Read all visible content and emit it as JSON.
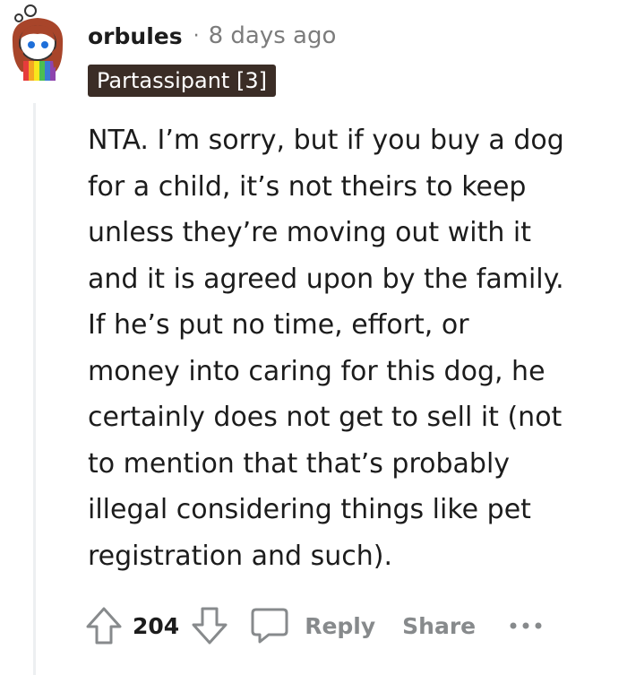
{
  "comment": {
    "author": "orbules",
    "separator": "·",
    "timestamp": "8 days ago",
    "flair": "Partassipant [3]",
    "body": "NTA. I’m sorry, but if you buy a dog\nfor a child, it’s not theirs to keep\nunless they’re moving out with it\nand it is agreed upon by the family.\nIf he’s put no time, effort, or\nmoney into caring for this dog, he\ncertainly does not get to sell it (not\nto mention that that’s probably\nillegal considering things like pet\nregistration and such).",
    "score": "204"
  },
  "actions": {
    "upvote_icon": "arrow-up-icon",
    "downvote_icon": "arrow-down-icon",
    "reply_icon": "speech-bubble-icon",
    "reply_label": "Reply",
    "share_label": "Share",
    "more_icon": "ellipsis-icon"
  },
  "colors": {
    "flair_bg": "#3b2d26",
    "muted_text": "#878a8c",
    "thread_line": "#edeff1"
  }
}
